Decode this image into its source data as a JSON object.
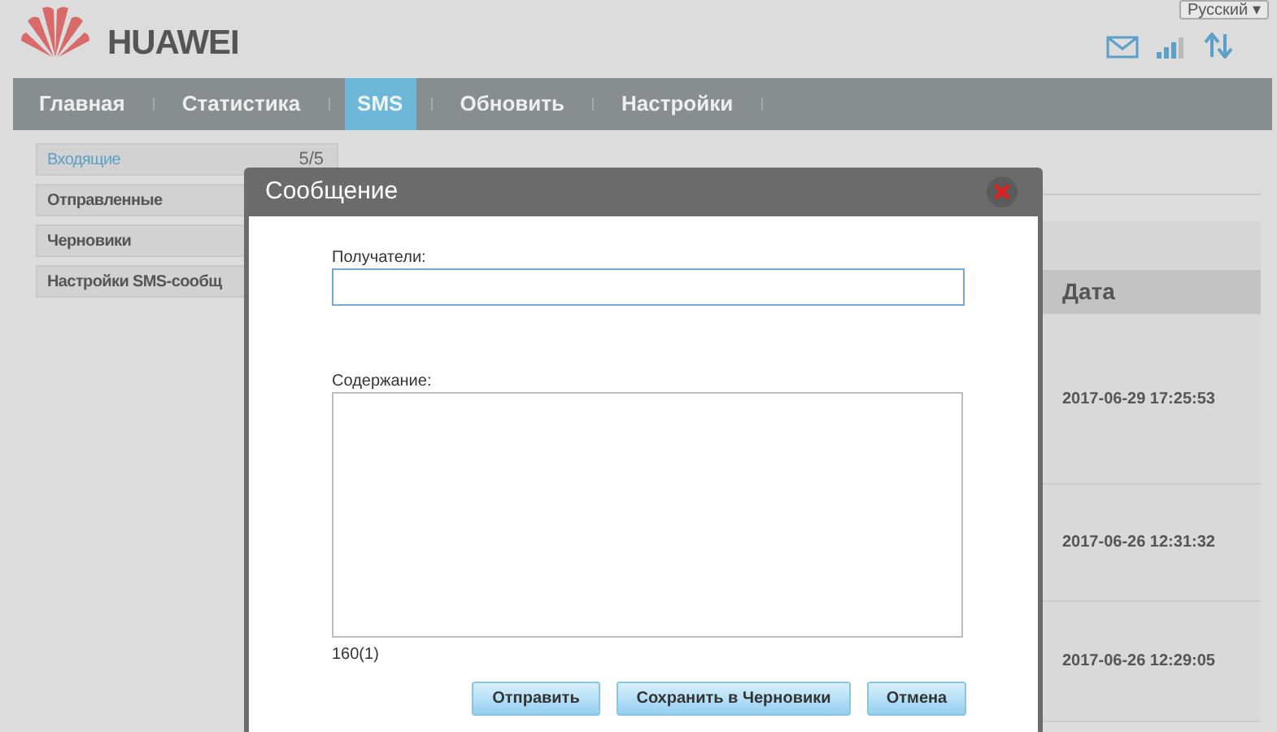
{
  "header": {
    "brand": "HUAWEI",
    "language": "Русский ▾"
  },
  "nav": [
    {
      "label": "Главная",
      "selected": false
    },
    {
      "label": "Статистика",
      "selected": false
    },
    {
      "label": "SMS",
      "selected": true
    },
    {
      "label": "Обновить",
      "selected": false
    },
    {
      "label": "Настройки",
      "selected": false
    }
  ],
  "sidebar": {
    "items": [
      {
        "label": "Входящие",
        "count": "5/5",
        "selected": true
      },
      {
        "label": "Отправленные",
        "selected": false
      },
      {
        "label": "Черновики",
        "selected": false
      },
      {
        "label": "Настройки SMS-сообщ",
        "selected": false
      }
    ]
  },
  "table": {
    "columns": [
      "Дата"
    ],
    "rows": [
      [
        "2017-06-29 17:25:53"
      ],
      [
        "2017-06-26 12:31:32"
      ],
      [
        "2017-06-26 12:29:05"
      ]
    ]
  },
  "dialog": {
    "title": "Сообщение",
    "recipients_label": "Получатели:",
    "content_label": "Содержание:",
    "counter": "160(1)",
    "buttons": [
      "Отправить",
      "Сохранить в Черновики",
      "Отмена"
    ]
  }
}
